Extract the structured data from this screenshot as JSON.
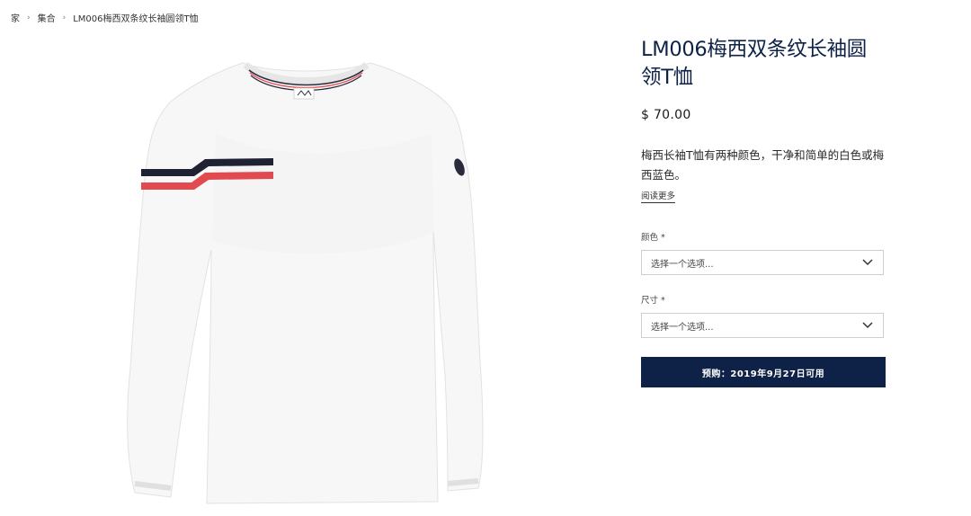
{
  "breadcrumb": {
    "home": "家",
    "category": "集合",
    "current": "LM006梅西双条纹长袖圆领T恤",
    "separator": "›"
  },
  "product": {
    "title": "LM006梅西双条纹长袖圆领T恤",
    "price": "$ 70.00",
    "description": "梅西长袖T恤有两种颜色，干净和简单的白色或梅西蓝色。",
    "read_more": "阅读更多"
  },
  "options": {
    "color_label": "颜色 *",
    "color_placeholder": "选择一个选项...",
    "size_label": "尺寸 *",
    "size_placeholder": "选择一个选项..."
  },
  "cta": {
    "label": "预购：2019年9月27日可用"
  },
  "colors": {
    "navy": "#0d2246",
    "stripe_red": "#e14a4f",
    "stripe_dark": "#1f2233"
  },
  "icons": {
    "select_arrow": "chevron-down-icon"
  }
}
